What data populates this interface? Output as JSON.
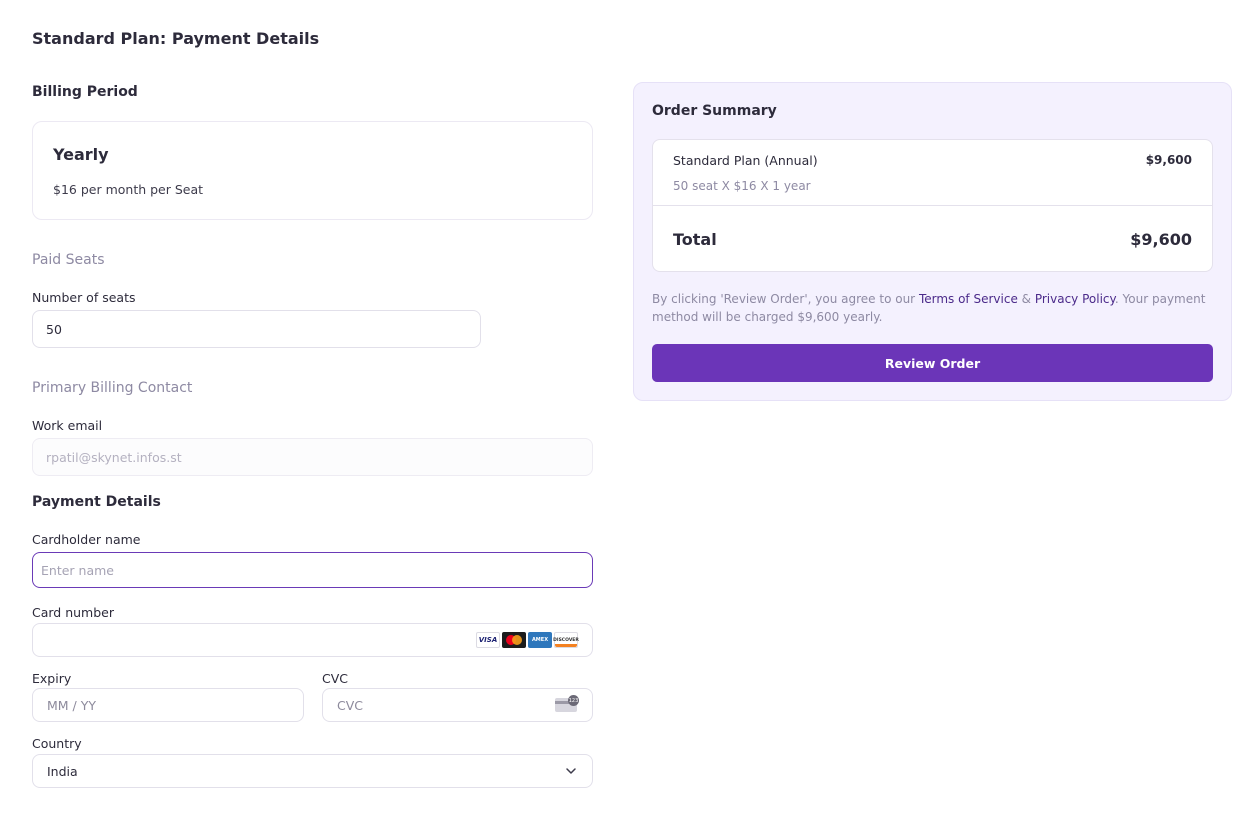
{
  "page": {
    "title": "Standard Plan: Payment Details"
  },
  "billing_period": {
    "heading": "Billing Period",
    "plan_name": "Yearly",
    "plan_price": "$16 per month per Seat"
  },
  "paid_seats": {
    "heading": "Paid Seats",
    "seats_label": "Number of seats",
    "seats_value": "50"
  },
  "billing_contact": {
    "heading": "Primary Billing Contact",
    "email_label": "Work email",
    "email_value": "rpatil@skynet.infos.st"
  },
  "payment": {
    "heading": "Payment Details",
    "cardholder_label": "Cardholder name",
    "cardholder_placeholder": "Enter name",
    "card_number_label": "Card number",
    "card_number_value": "",
    "card_brands": [
      "VISA",
      "MASTERCARD",
      "AMEX",
      "DISCOVER"
    ],
    "card_brand_labels": {
      "visa": "VISA",
      "amex": "AMEX",
      "discover": "DISCOVER"
    },
    "expiry_label": "Expiry",
    "expiry_placeholder": "MM / YY",
    "cvc_label": "CVC",
    "cvc_placeholder": "CVC",
    "cvc_icon_digits": "123",
    "country_label": "Country",
    "country_value": "India"
  },
  "order_summary": {
    "title": "Order Summary",
    "line_item_name": "Standard Plan (Annual)",
    "line_item_price": "$9,600",
    "line_item_detail": "50 seat X $16 X 1 year",
    "total_label": "Total",
    "total_value": "$9,600",
    "legal_prefix": "By clicking 'Review Order', you agree to our ",
    "terms_link": "Terms of Service",
    "legal_and": " & ",
    "privacy_link": "Privacy Policy",
    "legal_suffix": ". Your payment method will be charged $9,600 yearly.",
    "review_button": "Review Order"
  },
  "colors": {
    "accent": "#6b35b8",
    "summary_bg": "#f4f1fe",
    "link": "#4b2a8a",
    "muted_text": "#8e8aa3"
  }
}
